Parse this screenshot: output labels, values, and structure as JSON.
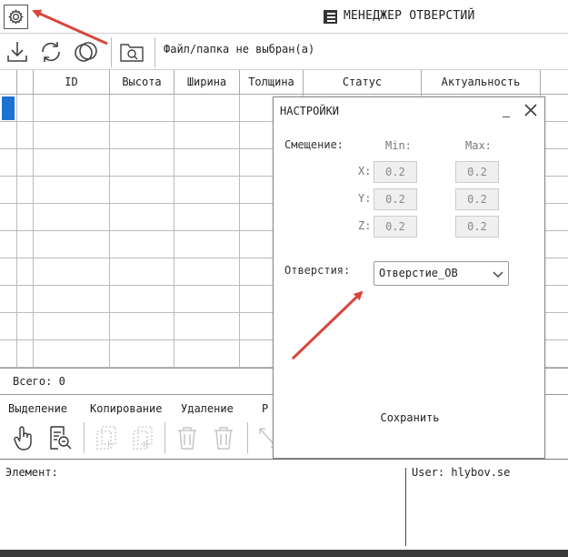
{
  "window": {
    "title": "МЕНЕДЖЕР ОТВЕРСТИЙ",
    "settings_icon": "gear-icon",
    "logo_icon": "app-logo-icon"
  },
  "toolbar": {
    "file_label": "Файл/папка не выбран(а)",
    "icons": [
      "download-icon",
      "refresh-icon",
      "circles-icon",
      "folder-search-icon"
    ]
  },
  "table": {
    "columns": [
      "",
      "",
      "ID",
      "Высота",
      "Ширина",
      "Толщина",
      "Статус",
      "Актуальность"
    ],
    "rows": [
      [],
      [],
      [],
      [],
      [],
      [],
      [],
      [],
      [],
      []
    ]
  },
  "summary": {
    "total_label": "Всего: 0"
  },
  "actions": {
    "groups": [
      {
        "label": "Выделение"
      },
      {
        "label": "Копирование"
      },
      {
        "label": "Удаление"
      },
      {
        "label": "Р"
      }
    ],
    "icons": [
      "hand-pointer-icon",
      "document-search-icon",
      "copy-1-icon",
      "copy-2-icon",
      "trash-1-icon",
      "trash-2-icon",
      "resize-icon"
    ]
  },
  "statusbar": {
    "element_label": "Элемент:",
    "user_label": "User: hlybov.se"
  },
  "settings_dialog": {
    "title": "НАСТРОЙКИ",
    "minimize_label": "_",
    "close_icon": "close-icon",
    "offset_label": "Смещение:",
    "min_label": "Min:",
    "max_label": "Max:",
    "axes": [
      {
        "label": "X:",
        "min": "0.2",
        "max": "0.2"
      },
      {
        "label": "Y:",
        "min": "0.2",
        "max": "0.2"
      },
      {
        "label": "Z:",
        "min": "0.2",
        "max": "0.2"
      }
    ],
    "hole_label": "Отверстия:",
    "hole_value": "Отверстие_ОВ",
    "save_label": "Сохранить"
  },
  "colors": {
    "selection": "#1e73d2",
    "annotation_arrow": "#d9463b"
  }
}
